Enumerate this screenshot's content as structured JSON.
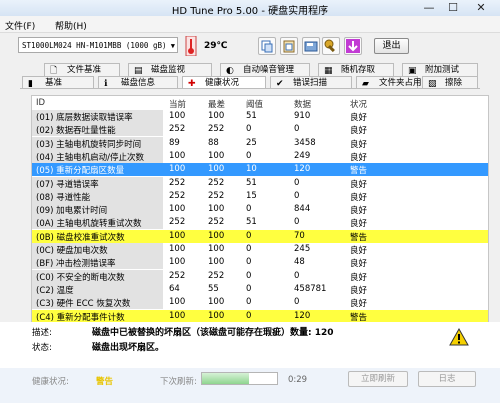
{
  "window": {
    "title": "HD Tune Pro 5.00 - 硬盘实用程序",
    "minimize": "—",
    "maximize": "☐",
    "close": "✕"
  },
  "menu": [
    "文件(F)",
    "帮助(H)"
  ],
  "toolbar": {
    "drive": "ST1000LM024 HN-M101MBB (1000 gB)",
    "temperature": "29℃",
    "exit_label": "退出"
  },
  "tabs_top": [
    {
      "label": "文件基准",
      "icon": "file-icon"
    },
    {
      "label": "磁盘监视",
      "icon": "monitor-icon"
    },
    {
      "label": "自动噪音管理",
      "icon": "speaker-icon"
    },
    {
      "label": "随机存取",
      "icon": "random-access-icon"
    },
    {
      "label": "附加测试",
      "icon": "extra-tests-icon"
    }
  ],
  "tabs_bottom": [
    {
      "label": "基准",
      "icon": "benchmark-icon"
    },
    {
      "label": "磁盘信息",
      "icon": "info-icon"
    },
    {
      "label": "健康状况",
      "icon": "health-cross-icon"
    },
    {
      "label": "错误扫描",
      "icon": "error-scan-icon"
    },
    {
      "label": "文件夹占用",
      "icon": "folder-icon"
    },
    {
      "label": "擦除",
      "icon": "erase-icon"
    }
  ],
  "table": {
    "headers": [
      "ID",
      "当前",
      "最差",
      "阈值",
      "数据",
      "状况"
    ],
    "rows": [
      {
        "id": "(01) 底层数据读取错误率",
        "current": "100",
        "worst": "100",
        "threshold": "51",
        "data": "910",
        "status": "良好",
        "style": "normal"
      },
      {
        "id": "(02) 数据吞吐量性能",
        "current": "252",
        "worst": "252",
        "threshold": "0",
        "data": "0",
        "status": "良好",
        "style": "normal"
      },
      {
        "id": "(03) 主轴电机旋转同步时间",
        "current": "89",
        "worst": "88",
        "threshold": "25",
        "data": "3458",
        "status": "良好",
        "style": "normal"
      },
      {
        "id": "(04) 主轴电机启动/停止次数",
        "current": "100",
        "worst": "100",
        "threshold": "0",
        "data": "249",
        "status": "良好",
        "style": "normal"
      },
      {
        "id": "(05) 重新分配扇区数量",
        "current": "100",
        "worst": "100",
        "threshold": "10",
        "data": "120",
        "status": "警告",
        "style": "selected"
      },
      {
        "id": "(07) 寻道错误率",
        "current": "252",
        "worst": "252",
        "threshold": "51",
        "data": "0",
        "status": "良好",
        "style": "normal"
      },
      {
        "id": "(08) 寻道性能",
        "current": "252",
        "worst": "252",
        "threshold": "15",
        "data": "0",
        "status": "良好",
        "style": "normal"
      },
      {
        "id": "(09) 加电累计时间",
        "current": "100",
        "worst": "100",
        "threshold": "0",
        "data": "844",
        "status": "良好",
        "style": "normal"
      },
      {
        "id": "(0A) 主轴电机旋转重试次数",
        "current": "252",
        "worst": "252",
        "threshold": "51",
        "data": "0",
        "status": "良好",
        "style": "normal"
      },
      {
        "id": "(0B) 磁盘校准重试次数",
        "current": "100",
        "worst": "100",
        "threshold": "0",
        "data": "70",
        "status": "警告",
        "style": "warning"
      },
      {
        "id": "(0C) 硬盘加电次数",
        "current": "100",
        "worst": "100",
        "threshold": "0",
        "data": "245",
        "status": "良好",
        "style": "normal"
      },
      {
        "id": "(BF) 冲击检测错误率",
        "current": "100",
        "worst": "100",
        "threshold": "0",
        "data": "48",
        "status": "良好",
        "style": "normal"
      },
      {
        "id": "(C0) 不安全的断电次数",
        "current": "252",
        "worst": "252",
        "threshold": "0",
        "data": "0",
        "status": "良好",
        "style": "normal"
      },
      {
        "id": "(C2) 温度",
        "current": "64",
        "worst": "55",
        "threshold": "0",
        "data": "458781",
        "status": "良好",
        "style": "normal"
      },
      {
        "id": "(C3) 硬件 ECC 恢复次数",
        "current": "100",
        "worst": "100",
        "threshold": "0",
        "data": "0",
        "status": "良好",
        "style": "normal"
      },
      {
        "id": "(C4) 重新分配事件计数",
        "current": "100",
        "worst": "100",
        "threshold": "0",
        "data": "120",
        "status": "警告",
        "style": "warning"
      }
    ]
  },
  "details": {
    "description_label": "描述:",
    "description": "磁盘中已被替换的坏扇区（该磁盘可能存在瑕疵）数量: 120",
    "state_label": "状态:",
    "state": "磁盘出现坏扇区。"
  },
  "statusbar": {
    "health_label": "健康状况:",
    "health_value": "警告",
    "next_refresh_label": "下次刷新:",
    "progress": 0.62,
    "timer": "0:29",
    "refresh_label": "立即刷新",
    "log_label": "日志"
  },
  "colors": {
    "selected_row": "#3399ff",
    "warning_row": "#ffff40",
    "health_warning_text": "#e8c400"
  }
}
